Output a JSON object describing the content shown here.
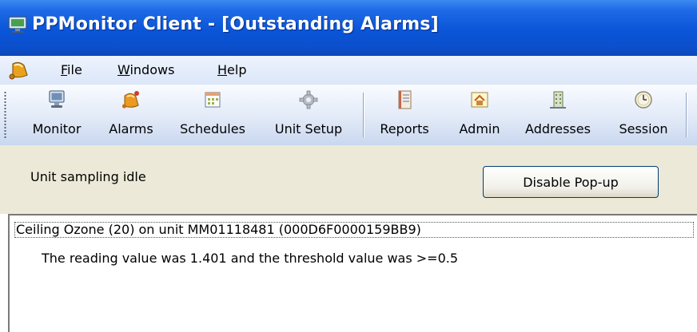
{
  "window": {
    "title": "PPMonitor Client - [Outstanding Alarms]",
    "title_bar_color": "#0a55d8"
  },
  "menu": {
    "items": [
      {
        "label": "File",
        "accel": "F",
        "rest": "ile"
      },
      {
        "label": "Windows",
        "accel": "W",
        "rest": "indows"
      },
      {
        "label": "Help",
        "accel": "H",
        "rest": "elp"
      }
    ]
  },
  "toolbar": {
    "buttons": [
      {
        "label": "Monitor",
        "icon": "monitor-icon"
      },
      {
        "label": "Alarms",
        "icon": "alarm-bell-icon"
      },
      {
        "label": "Schedules",
        "icon": "calendar-icon"
      },
      {
        "label": "Unit Setup",
        "icon": "gear-icon"
      },
      {
        "label": "Reports",
        "icon": "report-book-icon"
      },
      {
        "label": "Admin",
        "icon": "admin-house-icon"
      },
      {
        "label": "Addresses",
        "icon": "building-icon"
      },
      {
        "label": "Session",
        "icon": "clock-icon"
      }
    ]
  },
  "status": {
    "text": "Unit sampling idle",
    "disable_popup_label": "Disable Pop-up"
  },
  "alarms": [
    {
      "header": "Ceiling Ozone (20) on unit MM01118481 (000D6F0000159BB9)",
      "detail": "The reading value was 1.401 and the threshold value was >=0.5"
    }
  ]
}
